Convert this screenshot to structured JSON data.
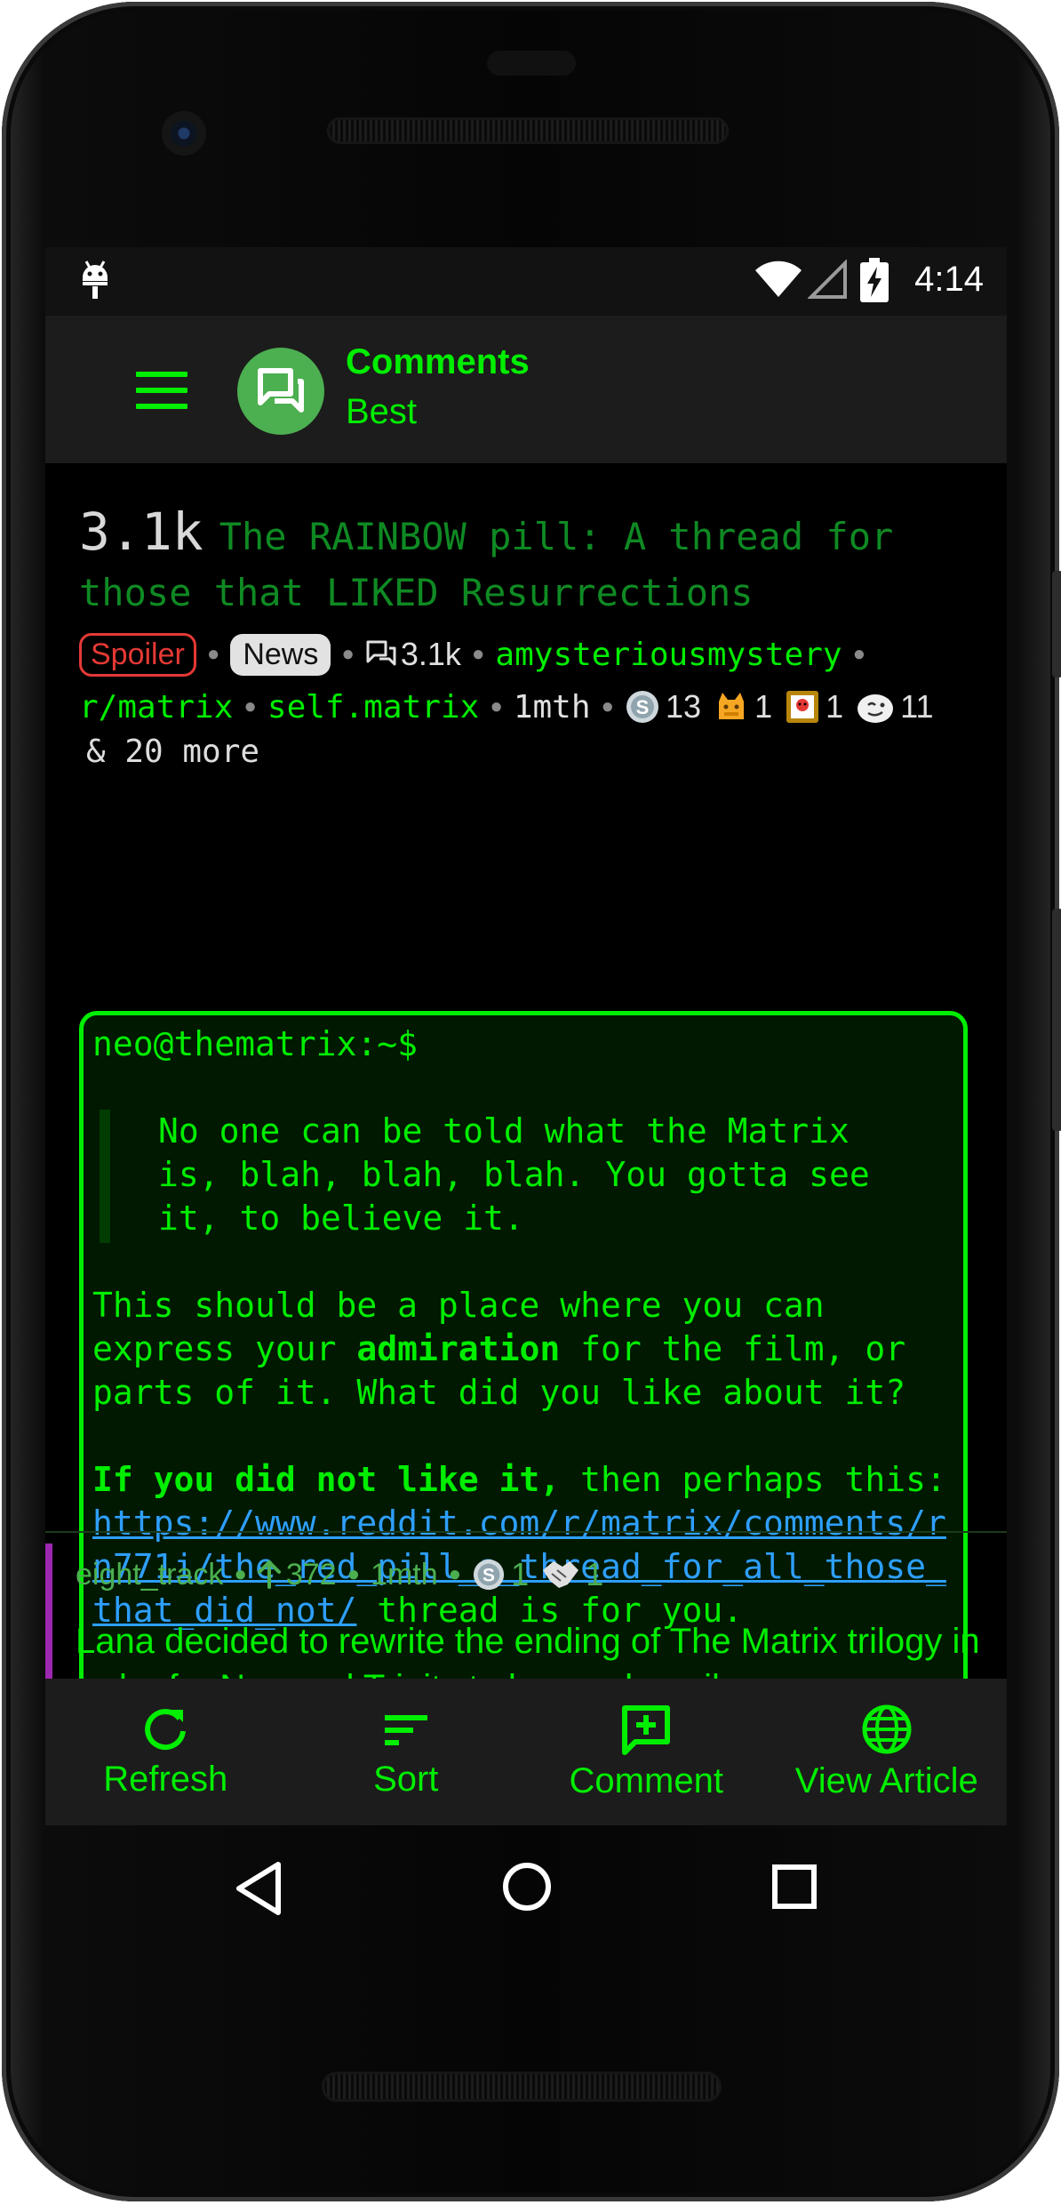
{
  "status_bar": {
    "time": "4:14"
  },
  "app_bar": {
    "title": "Comments",
    "subtitle": "Best"
  },
  "post": {
    "score": "3.1k",
    "title": "The RAINBOW pill: A thread for those that LIKED Resurrections",
    "flair_spoiler": "Spoiler",
    "flair_news": "News",
    "comment_count": "3.1k",
    "author": "amysteriousmystery",
    "subreddit": "r/matrix",
    "domain": "self.matrix",
    "age": "1mth",
    "awards": [
      {
        "icon": "silver-award-icon",
        "count": "13"
      },
      {
        "icon": "cat-award-icon",
        "count": "1"
      },
      {
        "icon": "frame-award-icon",
        "count": "1"
      },
      {
        "icon": "wink-award-icon",
        "count": "11"
      }
    ],
    "more_awards": "& 20 more",
    "body": {
      "prompt": "neo@thematrix:~$",
      "quote": "No one can be told what the Matrix\nis, blah, blah, blah. You gotta see\nit, to believe it.",
      "p1_before": "This should be a place where you can express your ",
      "p1_bold": "admiration",
      "p1_after": " for the film, or parts of it. What did you like about it?",
      "p2_bold": "If you did not like it,",
      "p2_before_link": " then perhaps this: ",
      "p2_link": "https://www.reddit.com/r/matrix/comments/rn771i/the_red_pill_a_thread_for_all_those_that_did_not/",
      "p2_after": " thread is for you."
    }
  },
  "comment": {
    "author": "eight_track",
    "score": "372",
    "age": "1mth",
    "awards": [
      {
        "icon": "silver-award-icon",
        "count": "1"
      },
      {
        "icon": "handshake-award-icon",
        "count": "1"
      }
    ],
    "body": "Lana decided to rewrite the ending of The Matrix trilogy in order for Neo and Trinity to have a happily"
  },
  "bottom_bar": {
    "refresh": "Refresh",
    "sort": "Sort",
    "comment": "Comment",
    "view_article": "View Article"
  },
  "colors": {
    "accent": "#00ee00",
    "title_green": "#0f8a23",
    "spoiler_red": "#e53935",
    "comment_bar": "#9c27b0",
    "link": "#2e9fff"
  }
}
